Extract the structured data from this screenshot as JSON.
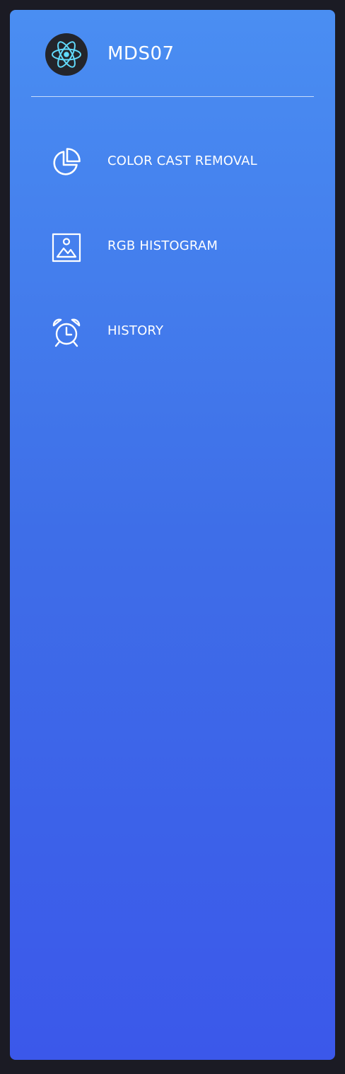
{
  "brand": {
    "name": "MDS07",
    "logo_icon": "react-atom-icon"
  },
  "menu": {
    "items": [
      {
        "label": "COLOR CAST REMOVAL",
        "icon": "pie-chart-icon"
      },
      {
        "label": "RGB HISTOGRAM",
        "icon": "image-icon"
      },
      {
        "label": "HISTORY",
        "icon": "alarm-clock-icon"
      }
    ]
  },
  "colors": {
    "background": "#1b1b24",
    "sidebar_gradient_top": "#4a8ef2",
    "sidebar_gradient_bottom": "#3b58ea",
    "logo_bg": "#23252b",
    "logo_accent": "#61dafb",
    "text": "#ffffff"
  }
}
